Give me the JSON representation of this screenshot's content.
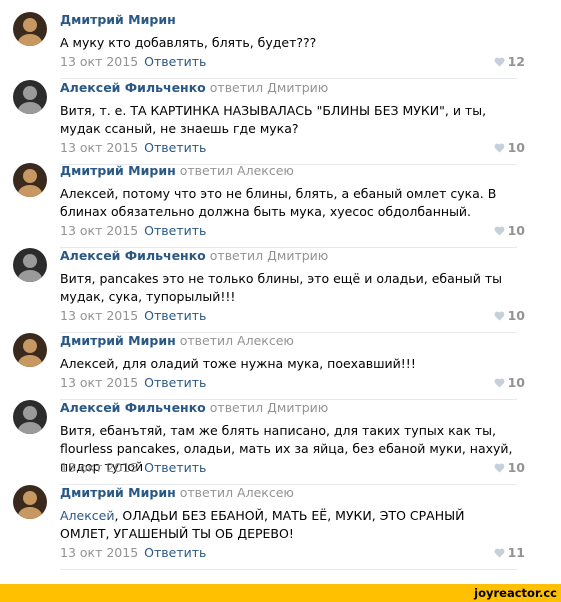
{
  "comments": [
    {
      "author": "Дмитрий Мирин",
      "replied": "",
      "avatar_icon": "user-avatar",
      "mention": "",
      "text": "А муку кто добавлять, блять, будет???",
      "date": "13 окт 2015",
      "reply_label": "Ответить",
      "likes": "12"
    },
    {
      "author": "Алексей Фильченко",
      "replied": "ответил Дмитрию",
      "avatar_icon": "user-avatar",
      "mention": "",
      "text": "Витя, т. е. ТА КАРТИНКА НАЗЫВАЛАСЬ \"БЛИНЫ БЕЗ МУКИ\", и ты, мудак ссаный, не знаешь где мука?",
      "date": "13 окт 2015",
      "reply_label": "Ответить",
      "likes": "10"
    },
    {
      "author": "Дмитрий Мирин",
      "replied": "ответил Алексею",
      "avatar_icon": "user-avatar",
      "mention": "",
      "text": "Алексей, потому что это не блины, блять, а ебаный омлет сука. В блинах обязательно должна быть мука, хуесос обдолбанный.",
      "date": "13 окт 2015",
      "reply_label": "Ответить",
      "likes": "10"
    },
    {
      "author": "Алексей Фильченко",
      "replied": "ответил Дмитрию",
      "avatar_icon": "user-avatar",
      "mention": "",
      "text": "Витя, pancakes это не только блины, это ещё и оладьи, ебаный ты мудак, сука, тупорылый!!!",
      "date": "13 окт 2015",
      "reply_label": "Ответить",
      "likes": "10"
    },
    {
      "author": "Дмитрий Мирин",
      "replied": "ответил Алексею",
      "avatar_icon": "user-avatar",
      "mention": "",
      "text": "Алексей, для оладий тоже нужна мука, поехавший!!!",
      "date": "13 окт 2015",
      "reply_label": "Ответить",
      "likes": "10"
    },
    {
      "author": "Алексей Фильченко",
      "replied": "ответил Дмитрию",
      "avatar_icon": "user-avatar",
      "mention": "",
      "text": "Витя, ебанътяй, там же блять написано, для таких тупых как ты, flourless pancakes, оладьи, мать их за яйца, без ебаной муки, нахуй, пидор тупой",
      "date": "13 окт 2015",
      "reply_label": "Ответить",
      "likes": "10"
    },
    {
      "author": "Дмитрий Мирин",
      "replied": "ответил Алексею",
      "avatar_icon": "user-avatar",
      "mention": "Алексей",
      "text": ", ОЛАДЬИ БЕЗ ЕБАНОЙ, МАТЬ ЕЁ, МУКИ, ЭТО СРАНЫЙ ОМЛЕТ, УГАШЕНЫЙ ТЫ ОБ ДЕРЕВО!",
      "date": "13 окт 2015",
      "reply_label": "Ответить",
      "likes": "11"
    }
  ],
  "like_icon": "heart-icon",
  "watermark": "joyreactor.cc",
  "colors": {
    "link": "#2a5885",
    "muted": "#939393",
    "divider": "#e7e8ec",
    "footer": "#ffc001"
  }
}
